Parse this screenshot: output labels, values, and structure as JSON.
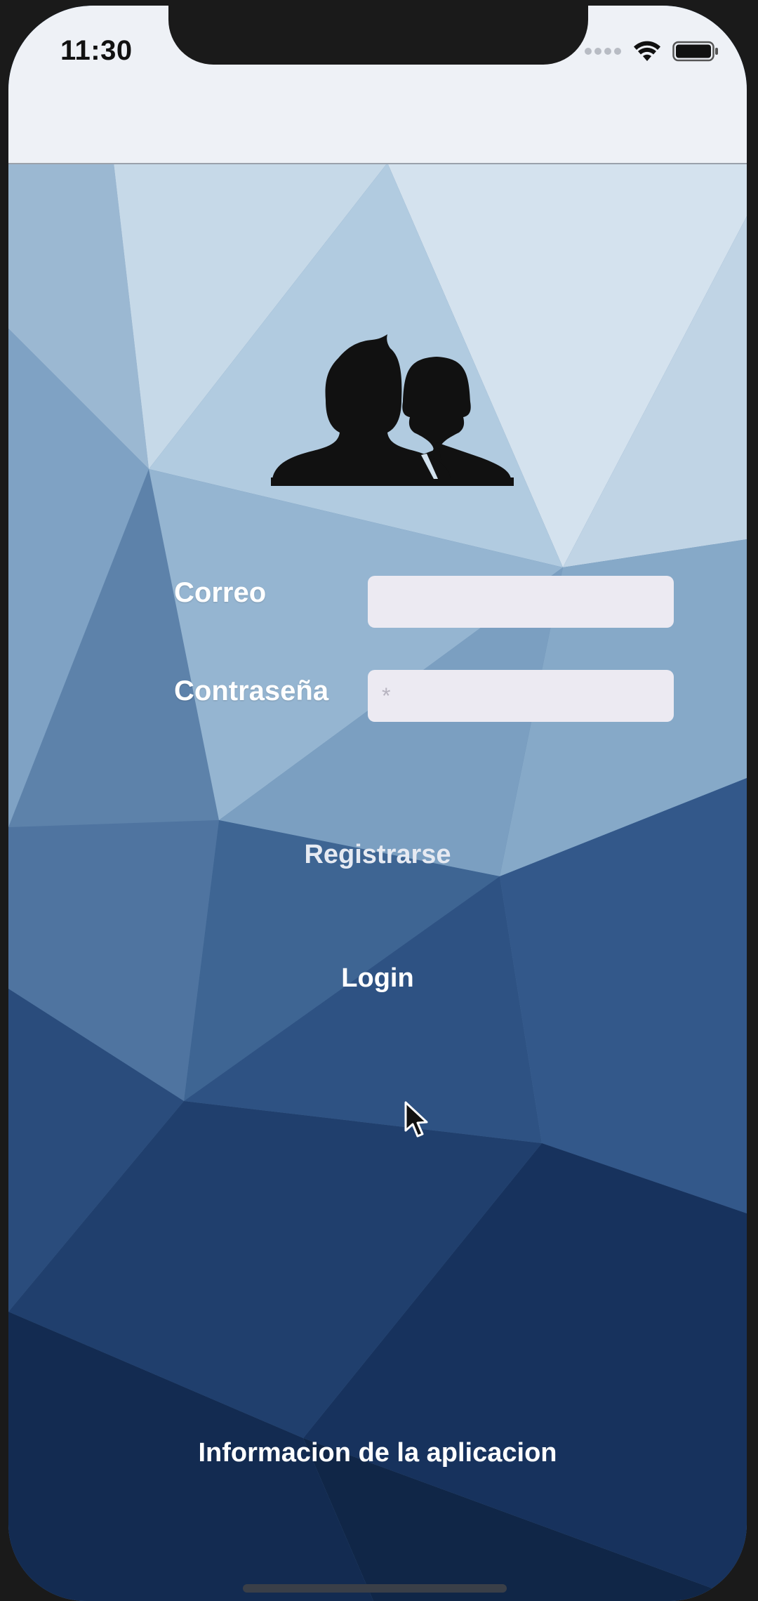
{
  "status_bar": {
    "time": "11:30",
    "icons": [
      "signal-icon",
      "wifi-icon",
      "battery-icon"
    ]
  },
  "login_form": {
    "email_label": "Correo",
    "email_value": "",
    "email_placeholder": "",
    "password_label": "Contraseña",
    "password_value": "",
    "password_placeholder": "*"
  },
  "actions": {
    "register_label": "Registrarse",
    "login_label": "Login",
    "app_info_label": "Informacion de la aplicacion"
  },
  "colors": {
    "nav_bar": "#eef1f6",
    "input_background": "#eceaf2",
    "register_text": "#e6eaf2",
    "bottom_background": "#0f2344"
  }
}
